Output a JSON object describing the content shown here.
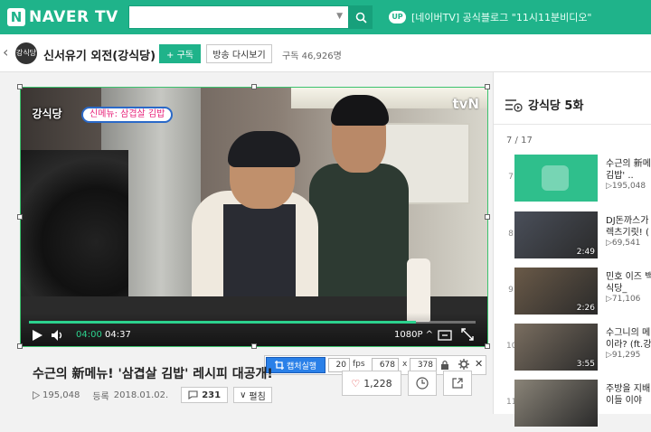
{
  "header": {
    "brand": "NAVER TV",
    "search": {
      "value": "",
      "placeholder": ""
    },
    "up_badge": "UP",
    "up_text": "[네이버TV] 공식블로그 \"11시11분비디오\""
  },
  "channel": {
    "name": "신서유기 외전(강식당)",
    "avatar_text": "강식당",
    "subscribe_label": "+ 구독",
    "replay_label": "방송 다시보기",
    "subscriber_text": "구독 46,926명"
  },
  "player": {
    "show_logo": "강식당",
    "caption": "신메뉴: 삼겹살 김밥",
    "channel_bug": "tvN",
    "time_current": "04:00",
    "time_total": "04:37",
    "progress": 0.867,
    "quality": "1080P"
  },
  "capture_bar": {
    "run_label": "캡처실행",
    "fps": "20",
    "fps_label": "fps",
    "width": "678",
    "x_label": "x",
    "height": "378"
  },
  "video": {
    "title": "수근의 新메뉴! '삼겹살 김밥' 레시피 대공개!",
    "views": "195,048",
    "date_label": "등록",
    "date": "2018.01.02.",
    "comments": "231",
    "expand_label": "펼침",
    "likes": "1,228"
  },
  "playlist": {
    "title": "강식당 5화",
    "position": "7 / 17",
    "items": [
      {
        "num": "7",
        "title": "수근의 新메",
        "title2": "김밥' ..",
        "views": "195,048",
        "duration": "",
        "color": "#2fbf8c"
      },
      {
        "num": "8",
        "title": "DJ돈까스가",
        "title2": "렉츠기릿! (",
        "views": "69,541",
        "duration": "2:49",
        "color": "#4a4f5a"
      },
      {
        "num": "9",
        "title": "민호 이즈 백",
        "title2": "식당_",
        "views": "71,106",
        "duration": "2:26",
        "color": "#6a5a48"
      },
      {
        "num": "10",
        "title": "수그니의 메",
        "title2": "이라? (ft.강",
        "views": "91,295",
        "duration": "3:55",
        "color": "#7a6e60"
      },
      {
        "num": "11",
        "title": "주방을 지배",
        "title2": "이들 이야",
        "views": "",
        "duration": "",
        "color": "#8a8478"
      }
    ]
  }
}
